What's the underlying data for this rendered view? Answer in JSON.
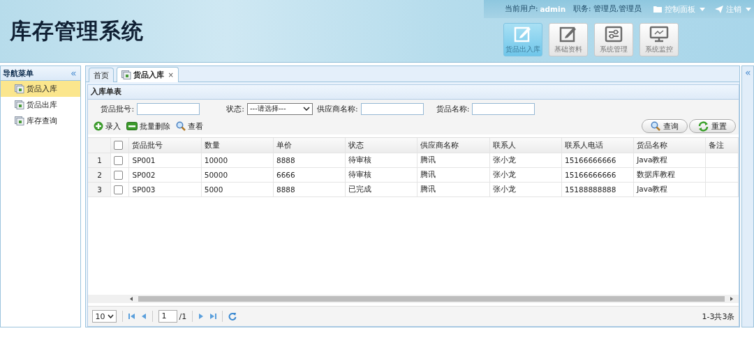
{
  "header": {
    "title": "库存管理系统",
    "user_label": "当前用户:",
    "user": "admin",
    "role_label": "职务:",
    "role": "管理员,管理员",
    "menus": [
      {
        "label": "控制面板",
        "kind": "folder"
      },
      {
        "label": "注销",
        "kind": "plane"
      }
    ],
    "nav_buttons": [
      {
        "label": "货品出入库",
        "kind": "edit",
        "selected": true
      },
      {
        "label": "基础资料",
        "kind": "edit",
        "selected": false
      },
      {
        "label": "系统管理",
        "kind": "sliders",
        "selected": false
      },
      {
        "label": "系统监控",
        "kind": "monitor",
        "selected": false
      }
    ]
  },
  "sidebar": {
    "title": "导航菜单",
    "collapse": "«",
    "items": [
      {
        "label": "货品入库",
        "selected": true
      },
      {
        "label": "货品出库",
        "selected": false
      },
      {
        "label": "库存查询",
        "selected": false
      }
    ]
  },
  "right_collapse": "«",
  "tabs": [
    {
      "label": "首页",
      "selected": false
    },
    {
      "label": "货品入库",
      "selected": true,
      "close": "×"
    }
  ],
  "panel": {
    "title": "入库单表",
    "filters": [
      {
        "kind": "text",
        "label": "货品批号:"
      },
      {
        "kind": "select",
        "label": "状态:",
        "value": "---请选择---"
      },
      {
        "kind": "text",
        "label": "供应商名称:"
      },
      {
        "kind": "text",
        "label": "货品名称:"
      }
    ],
    "toolbar": [
      {
        "label": "录入",
        "kind": "add"
      },
      {
        "label": "批量删除",
        "kind": "remove"
      },
      {
        "label": "查看",
        "kind": "search"
      }
    ],
    "buttons": [
      {
        "label": "查询",
        "kind": "search"
      },
      {
        "label": "重置",
        "kind": "reload"
      }
    ],
    "table": {
      "header_checked": false,
      "columns": [
        "货品批号",
        "数量",
        "单价",
        "状态",
        "供应商名称",
        "联系人",
        "联系人电话",
        "货品名称",
        "备注"
      ],
      "rows": [
        {
          "number": "1",
          "checked": false,
          "cells": [
            "SP001",
            "10000",
            "8888",
            "待审核",
            "腾讯",
            "张小龙",
            "15166666666",
            "Java教程",
            ""
          ]
        },
        {
          "number": "2",
          "checked": false,
          "cells": [
            "SP002",
            "50000",
            "6666",
            "待审核",
            "腾讯",
            "张小龙",
            "15166666666",
            "数据库教程",
            ""
          ]
        },
        {
          "number": "3",
          "checked": false,
          "cells": [
            "SP003",
            "5000",
            "8888",
            "已完成",
            "腾讯",
            "张小龙",
            "15188888888",
            "Java教程",
            ""
          ]
        }
      ]
    },
    "pager": {
      "page_size": "10",
      "page": "1",
      "total_pages": "/1",
      "summary": "1-3共3条"
    }
  }
}
